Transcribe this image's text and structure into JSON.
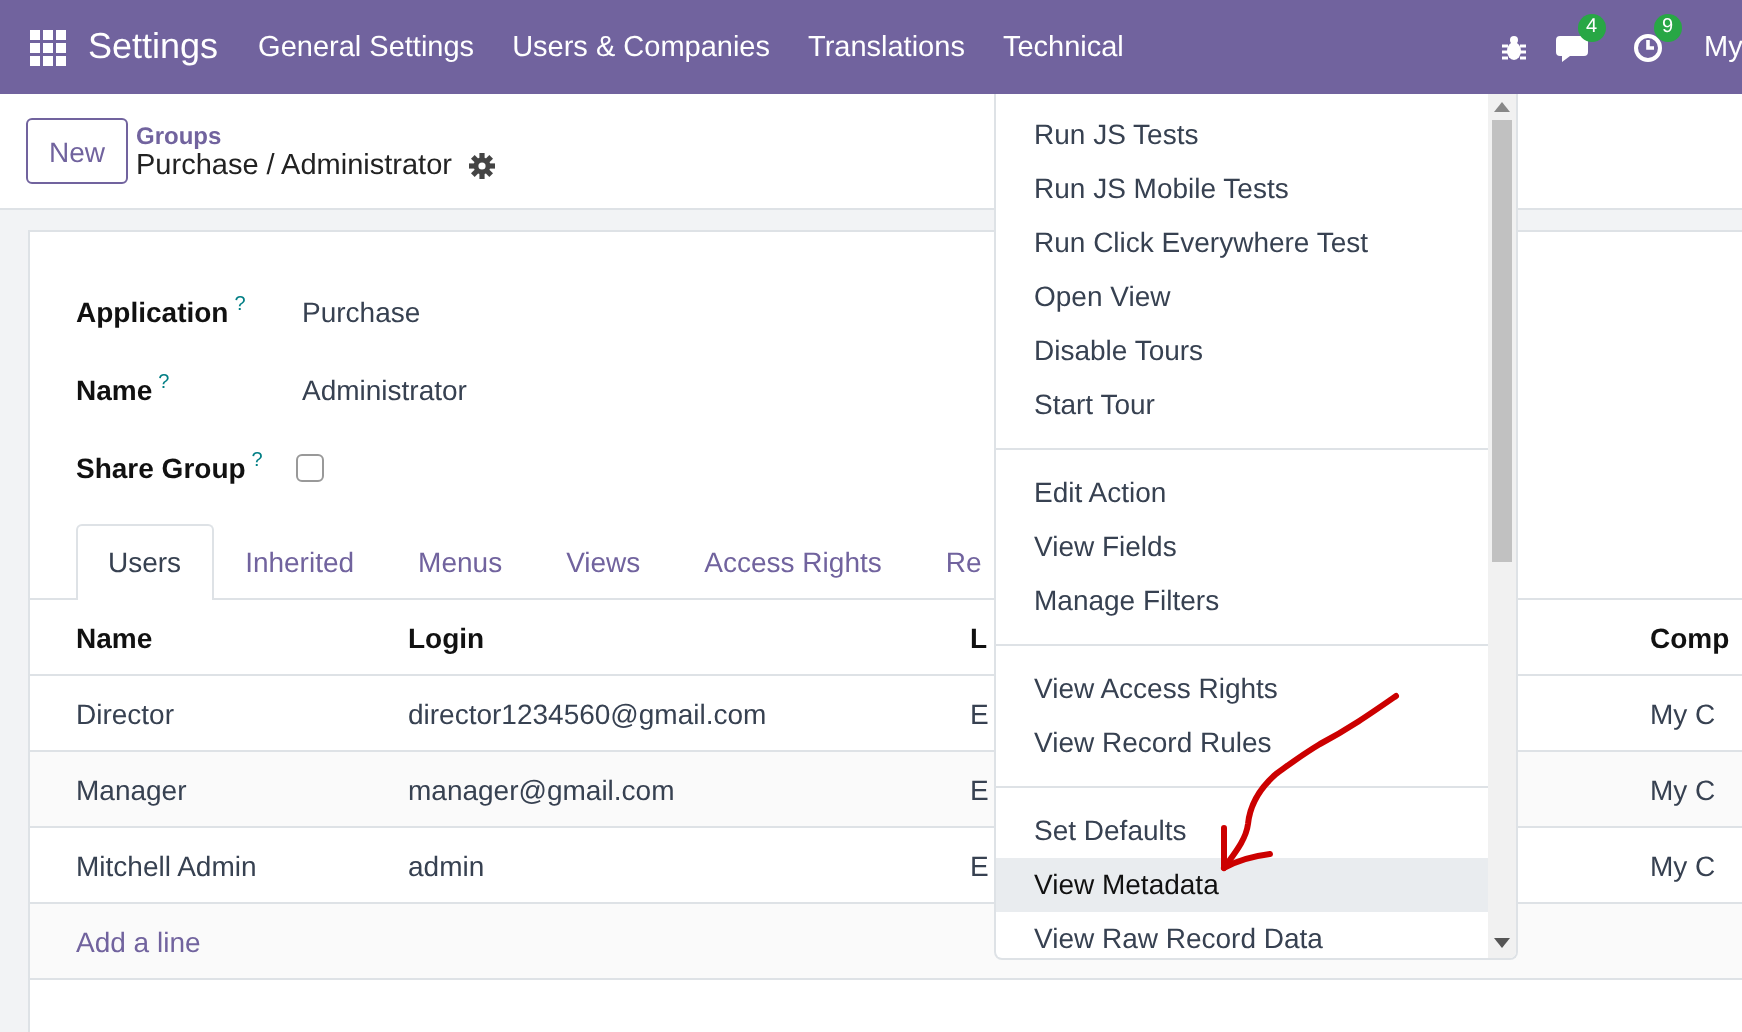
{
  "navbar": {
    "app_title": "Settings",
    "menus": [
      "General Settings",
      "Users & Companies",
      "Translations",
      "Technical"
    ],
    "systray": [
      {
        "kind": "bug"
      },
      {
        "kind": "chat",
        "badge": "4"
      },
      {
        "kind": "clock",
        "badge": "9"
      }
    ],
    "user": "My"
  },
  "control_panel": {
    "new_button": "New",
    "breadcrumb": "Groups",
    "record_title": "Purchase / Administrator"
  },
  "form": {
    "fields": [
      {
        "label": "Application",
        "help": "?",
        "kind": "text",
        "value": "Purchase"
      },
      {
        "label": "Name",
        "help": "?",
        "kind": "text",
        "value": "Administrator"
      },
      {
        "label": "Share Group",
        "help": "?",
        "kind": "checkbox",
        "checked": false
      }
    ]
  },
  "tabs": [
    {
      "label": "Users",
      "selected": true
    },
    {
      "label": "Inherited",
      "selected": false
    },
    {
      "label": "Menus",
      "selected": false
    },
    {
      "label": "Views",
      "selected": false
    },
    {
      "label": "Access Rights",
      "selected": false
    },
    {
      "label": "Re",
      "selected": false
    }
  ],
  "table": {
    "columns": [
      "Name",
      "Login",
      "L",
      "Comp"
    ],
    "rows": [
      [
        "Director",
        "director1234560@gmail.com",
        "E",
        "My C"
      ],
      [
        "Manager",
        "manager@gmail.com",
        "E",
        "My C"
      ],
      [
        "Mitchell Admin",
        "admin",
        "E",
        "My C"
      ]
    ],
    "add_line": "Add a line"
  },
  "dropdown": {
    "groups": [
      [
        {
          "label": "Run JS Tests",
          "highlighted": false
        },
        {
          "label": "Run JS Mobile Tests",
          "highlighted": false
        },
        {
          "label": "Run Click Everywhere Test",
          "highlighted": false
        },
        {
          "label": "Open View",
          "highlighted": false
        },
        {
          "label": "Disable Tours",
          "highlighted": false
        },
        {
          "label": "Start Tour",
          "highlighted": false
        }
      ],
      [
        {
          "label": "Edit Action",
          "highlighted": false
        },
        {
          "label": "View Fields",
          "highlighted": false
        },
        {
          "label": "Manage Filters",
          "highlighted": false
        }
      ],
      [
        {
          "label": "View Access Rights",
          "highlighted": false
        },
        {
          "label": "View Record Rules",
          "highlighted": false
        }
      ],
      [
        {
          "label": "Set Defaults",
          "highlighted": false
        },
        {
          "label": "View Metadata",
          "highlighted": true
        },
        {
          "label": "View Raw Record Data",
          "highlighted": false
        }
      ]
    ]
  }
}
